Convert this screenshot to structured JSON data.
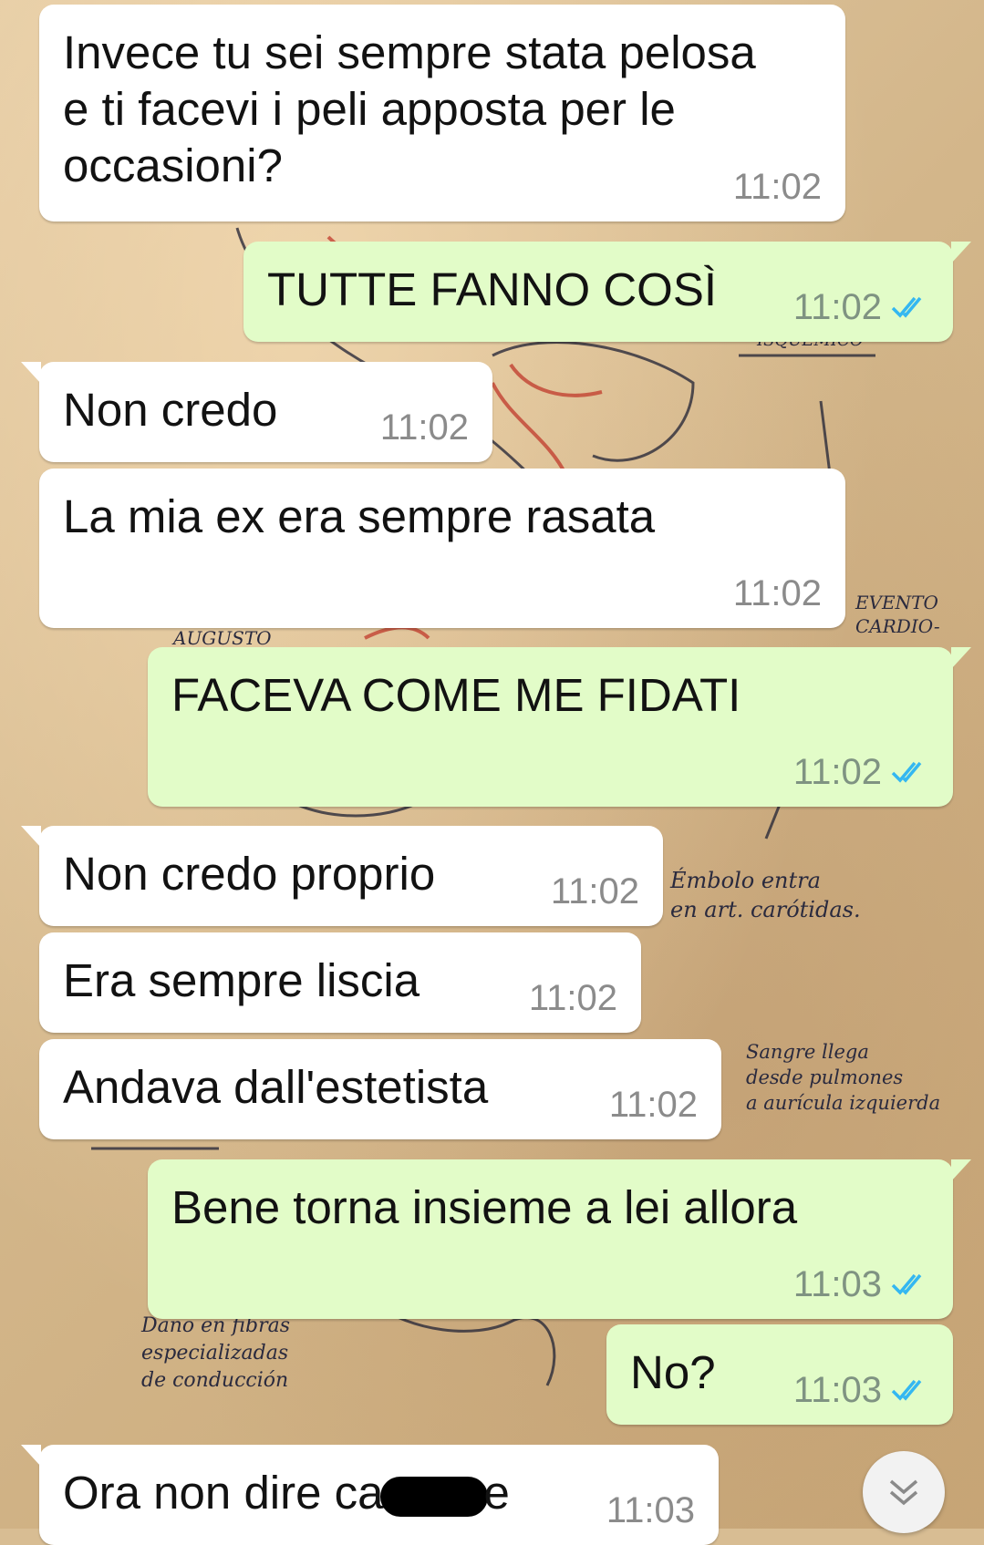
{
  "wallpaper": {
    "notes": [
      "EVENTO\nCARDIO-",
      "Émbolo entra\nen art. carótidas.",
      "Sangre llega\ndesde pulmones\na aurícula izquierda",
      "Daño en fibras\nespecializadas\nde conducción",
      "AUGUSTO",
      "ISQUEMICO"
    ]
  },
  "messages": [
    {
      "direction": "in",
      "text": "Invece tu sei sempre stata pelosa e ti facevi i peli apposta per le occasioni?",
      "time": "11:02"
    },
    {
      "direction": "out",
      "text": "TUTTE FANNO COSÌ",
      "time": "11:02",
      "status": "read"
    },
    {
      "direction": "in",
      "text": "Non credo",
      "time": "11:02"
    },
    {
      "direction": "in",
      "text": "La mia ex era sempre rasata",
      "time": "11:02"
    },
    {
      "direction": "out",
      "text": "FACEVA COME ME FIDATI",
      "time": "11:02",
      "status": "read"
    },
    {
      "direction": "in",
      "text": "Non credo proprio",
      "time": "11:02"
    },
    {
      "direction": "in",
      "text": "Era sempre liscia",
      "time": "11:02"
    },
    {
      "direction": "in",
      "text": "Andava dall'estetista",
      "time": "11:02"
    },
    {
      "direction": "out",
      "text": "Bene torna insieme a lei allora",
      "time": "11:03",
      "status": "read"
    },
    {
      "direction": "out",
      "text": "No?",
      "time": "11:03",
      "status": "read"
    },
    {
      "direction": "in",
      "text_before": "Ora non dire ca",
      "text_after": "e",
      "redacted": true,
      "time": "11:03"
    }
  ],
  "icons": {
    "read_receipt": "double-check-icon",
    "scroll_down": "chevron-double-down-icon"
  },
  "colors": {
    "incoming_bubble": "#ffffff",
    "outgoing_bubble": "#e2fcc8",
    "read_tick": "#34b7f1",
    "timestamp": "#8b8b8b"
  }
}
